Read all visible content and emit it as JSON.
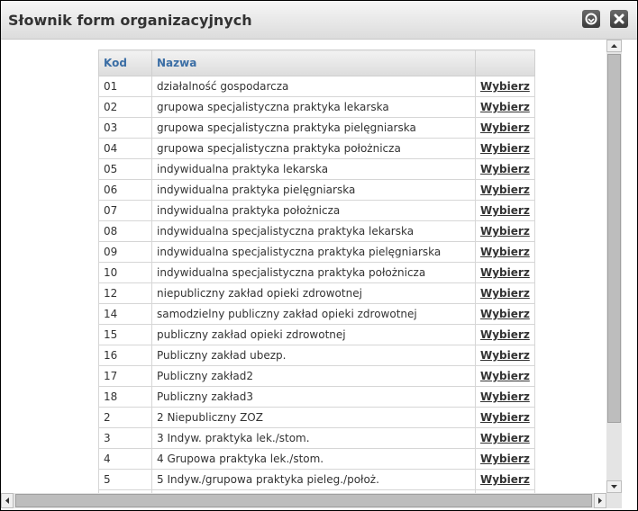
{
  "dialog": {
    "title": "Słownik form organizacyjnych"
  },
  "table": {
    "headers": {
      "code": "Kod",
      "name": "Nazwa",
      "action": ""
    },
    "select_label": "Wybierz",
    "rows": [
      {
        "code": "01",
        "name": "działalność gospodarcza"
      },
      {
        "code": "02",
        "name": "grupowa specjalistyczna praktyka lekarska"
      },
      {
        "code": "03",
        "name": "grupowa specjalistyczna praktyka pielęgniarska"
      },
      {
        "code": "04",
        "name": "grupowa specjalistyczna praktyka położnicza"
      },
      {
        "code": "05",
        "name": "indywidualna praktyka lekarska"
      },
      {
        "code": "06",
        "name": "indywidualna praktyka pielęgniarska"
      },
      {
        "code": "07",
        "name": "indywidualna praktyka położnicza"
      },
      {
        "code": "08",
        "name": "indywidualna specjalistyczna praktyka lekarska"
      },
      {
        "code": "09",
        "name": "indywidualna specjalistyczna praktyka pielęgniarska"
      },
      {
        "code": "10",
        "name": "indywidualna specjalistyczna praktyka położnicza"
      },
      {
        "code": "12",
        "name": "niepubliczny zakład opieki zdrowotnej"
      },
      {
        "code": "14",
        "name": "samodzielny publiczny zakład opieki zdrowotnej"
      },
      {
        "code": "15",
        "name": "publiczny zakład opieki zdrowotnej"
      },
      {
        "code": "16",
        "name": "Publiczny zakład ubezp."
      },
      {
        "code": "17",
        "name": "Publiczny zakład2"
      },
      {
        "code": "18",
        "name": "Publiczny zakład3"
      },
      {
        "code": "2",
        "name": "2 Niepubliczny ZOZ"
      },
      {
        "code": "3",
        "name": "3 Indyw. praktyka lek./stom."
      },
      {
        "code": "4",
        "name": "4 Grupowa praktyka lek./stom."
      },
      {
        "code": "5",
        "name": "5 Indyw./grupowa praktyka pieleg./położ."
      },
      {
        "code": "",
        "name": ""
      }
    ]
  },
  "icons": {
    "minimize": "minimize-icon",
    "close": "close-icon"
  }
}
